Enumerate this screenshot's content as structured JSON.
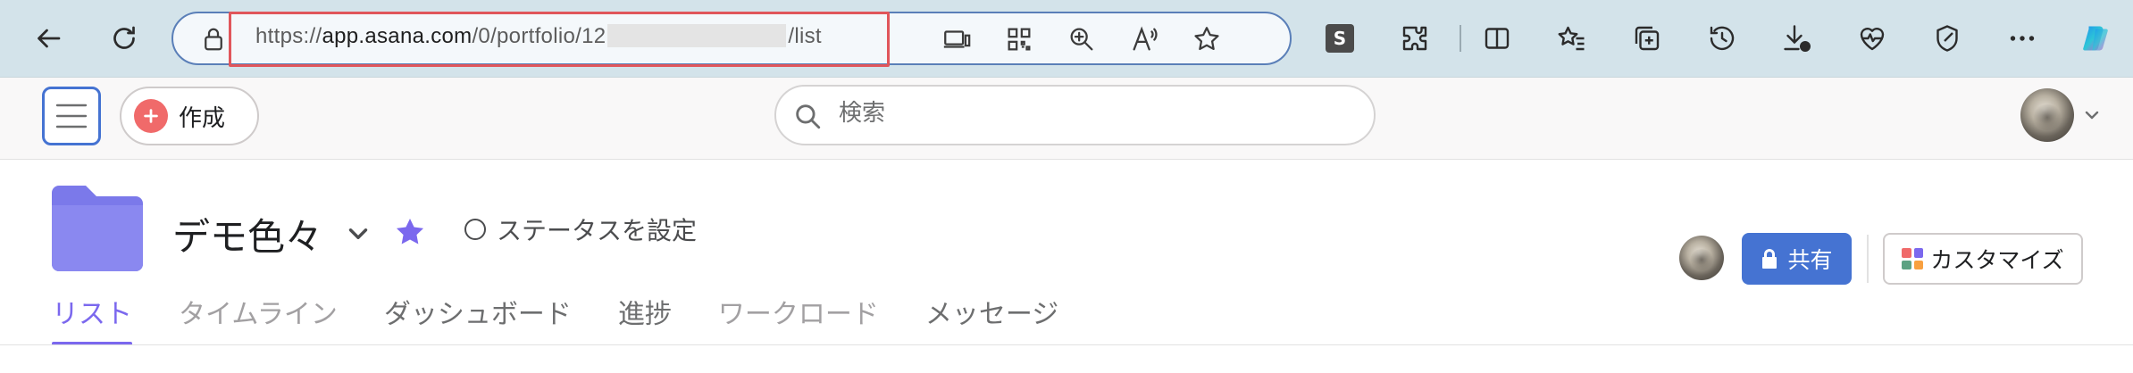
{
  "browser": {
    "url_prefix": "https://",
    "url_domain": "app.asana.com",
    "url_path_start": "/0/portfolio/12",
    "url_path_end": "/list",
    "extension_badge": "S",
    "icons": [
      "back-icon",
      "refresh-icon",
      "lock-icon",
      "device-icon",
      "qr-icon",
      "zoom-icon",
      "read-aloud-icon",
      "favorite-icon",
      "extension-s-icon",
      "puzzle-icon",
      "split-icon",
      "favorites-icon",
      "collections-icon",
      "history-icon",
      "downloads-icon",
      "health-icon",
      "performance-icon",
      "more-icon",
      "copilot-icon"
    ]
  },
  "topbar": {
    "create_label": "作成",
    "search_placeholder": "検索"
  },
  "project": {
    "title": "デモ色々",
    "status_label": "ステータスを設定",
    "share_label": "共有",
    "customize_label": "カスタマイズ"
  },
  "tabs": [
    {
      "label": "リスト",
      "state": "active"
    },
    {
      "label": "タイムライン",
      "state": "muted"
    },
    {
      "label": "ダッシュボード",
      "state": "normal"
    },
    {
      "label": "進捗",
      "state": "normal"
    },
    {
      "label": "ワークロード",
      "state": "muted"
    },
    {
      "label": "メッセージ",
      "state": "normal"
    }
  ],
  "colors": {
    "accent_purple": "#7b68ee",
    "share_blue": "#4573d2",
    "create_red": "#f06a6a",
    "folder_purple": "#7b79ea"
  }
}
